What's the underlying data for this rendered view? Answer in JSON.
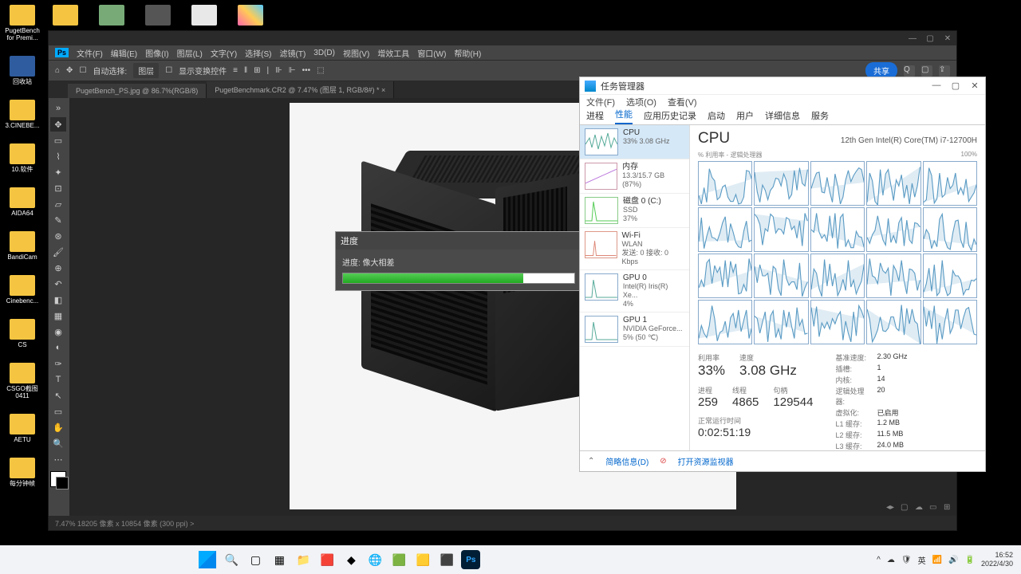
{
  "desktop": {
    "col": [
      {
        "label": "PugetBench for Premi..."
      },
      {
        "label": "回收站"
      },
      {
        "label": "3.CINEBE..."
      },
      {
        "label": "10.软件"
      },
      {
        "label": "AIDA64"
      },
      {
        "label": "BandiCam"
      },
      {
        "label": "Cinebenc..."
      },
      {
        "label": "CS"
      },
      {
        "label": "CSGO截图0411"
      },
      {
        "label": "AETU"
      },
      {
        "label": "每分钟帧"
      }
    ],
    "row2": [
      {
        "label": ""
      },
      {
        "label": ""
      },
      {
        "label": ""
      },
      {
        "label": ""
      },
      {
        "label": ""
      }
    ]
  },
  "ps": {
    "menu": [
      "文件(F)",
      "编辑(E)",
      "图像(I)",
      "图层(L)",
      "文字(Y)",
      "选择(S)",
      "滤镜(T)",
      "3D(D)",
      "视图(V)",
      "增效工具",
      "窗口(W)",
      "帮助(H)"
    ],
    "options": {
      "auto": "自动选择:",
      "layer": "图层",
      "show": "显示变换控件",
      "share": "共享"
    },
    "tabs": [
      "PugetBench_PS.jpg @ 86.7%(RGB/8)",
      "PugetBenchmark.CR2 @ 7.47% (图层 1, RGB/8#) *"
    ],
    "status": "7.47%   18205 像素 x 10854 像素 (300 ppi)   >",
    "progress": {
      "title": "进度",
      "label": "进度: 像大相差",
      "pct": 78
    }
  },
  "tm": {
    "title": "任务管理器",
    "menu": [
      "文件(F)",
      "选项(O)",
      "查看(V)"
    ],
    "tabs": [
      "进程",
      "性能",
      "应用历史记录",
      "启动",
      "用户",
      "详细信息",
      "服务"
    ],
    "side": [
      {
        "name": "CPU",
        "detail": "33% 3.08 GHz"
      },
      {
        "name": "内存",
        "detail": "13.3/15.7 GB (87%)"
      },
      {
        "name": "磁盘 0 (C:)",
        "detail": "SSD",
        "detail2": "37%"
      },
      {
        "name": "Wi-Fi",
        "detail": "WLAN",
        "detail2": "发送: 0 接收: 0 Kbps"
      },
      {
        "name": "GPU 0",
        "detail": "Intel(R) Iris(R) Xe...",
        "detail2": "4%"
      },
      {
        "name": "GPU 1",
        "detail": "NVIDIA GeForce...",
        "detail2": "5% (50 ℃)"
      }
    ],
    "main": {
      "title": "CPU",
      "sub": "12th Gen Intel(R) Core(TM) i7-12700H",
      "caption_l": "% 利用率 - 逻辑处理器",
      "caption_r": "100%",
      "stats": {
        "util_l": "利用率",
        "util": "33%",
        "speed_l": "速度",
        "speed": "3.08 GHz",
        "proc_l": "进程",
        "proc": "259",
        "thr_l": "线程",
        "thr": "4865",
        "hnd_l": "句柄",
        "hnd": "129544",
        "up_l": "正常运行时间",
        "up": "0:02:51:19"
      },
      "info": [
        {
          "k": "基准速度:",
          "v": "2.30 GHz"
        },
        {
          "k": "插槽:",
          "v": "1"
        },
        {
          "k": "内核:",
          "v": "14"
        },
        {
          "k": "逻辑处理器:",
          "v": "20"
        },
        {
          "k": "虚拟化:",
          "v": "已启用"
        },
        {
          "k": "L1 缓存:",
          "v": "1.2 MB"
        },
        {
          "k": "L2 缓存:",
          "v": "11.5 MB"
        },
        {
          "k": "L3 缓存:",
          "v": "24.0 MB"
        }
      ]
    },
    "foot": {
      "less": "简略信息(D)",
      "open": "打开资源监视器"
    }
  },
  "taskbar": {
    "time": "16:52",
    "date": "2022/4/30"
  }
}
